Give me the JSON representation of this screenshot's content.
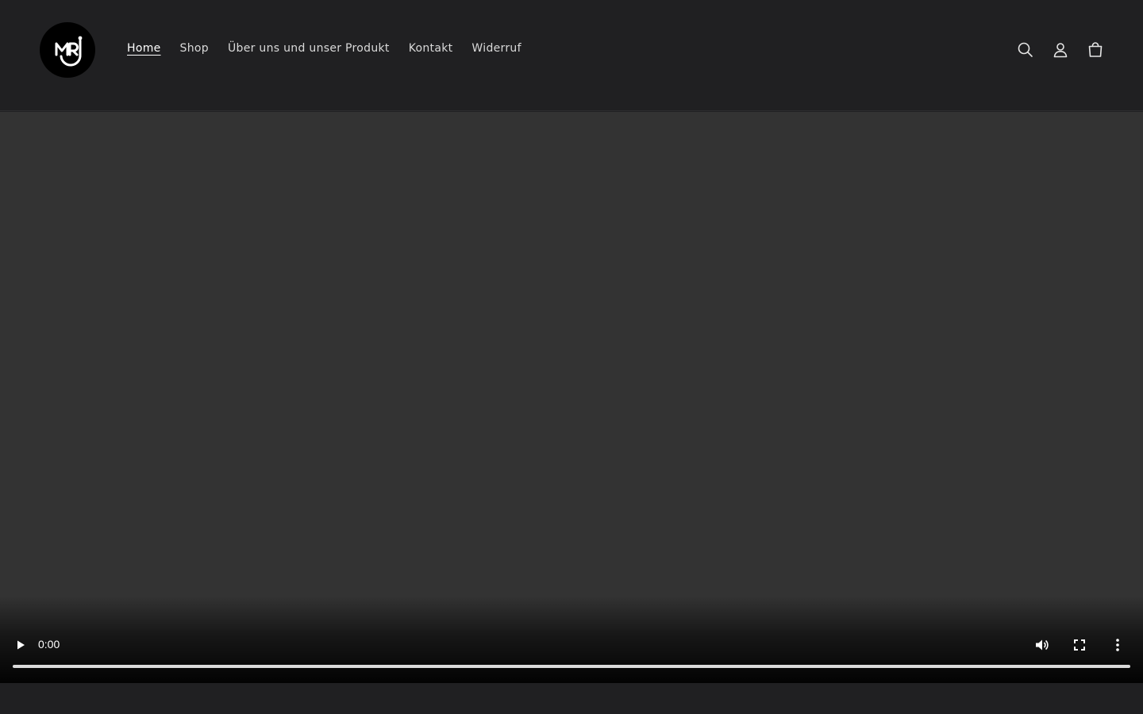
{
  "header": {
    "logo_text": "MRJ",
    "logo_icon": "mrj-logo-icon",
    "nav": [
      {
        "label": "Home",
        "active": true
      },
      {
        "label": "Shop",
        "active": false
      },
      {
        "label": "Über uns und unser Produkt",
        "active": false
      },
      {
        "label": "Kontakt",
        "active": false
      },
      {
        "label": "Widerruf",
        "active": false
      }
    ],
    "icons": [
      "search-icon",
      "account-icon",
      "cart-icon"
    ]
  },
  "video": {
    "time": "0:00",
    "progress": 0,
    "controls": [
      "play-icon",
      "volume-icon",
      "fullscreen-icon",
      "more-options-icon"
    ]
  },
  "colors": {
    "background": "#202022",
    "video_background": "#333333",
    "text": "#d9d9d9"
  }
}
